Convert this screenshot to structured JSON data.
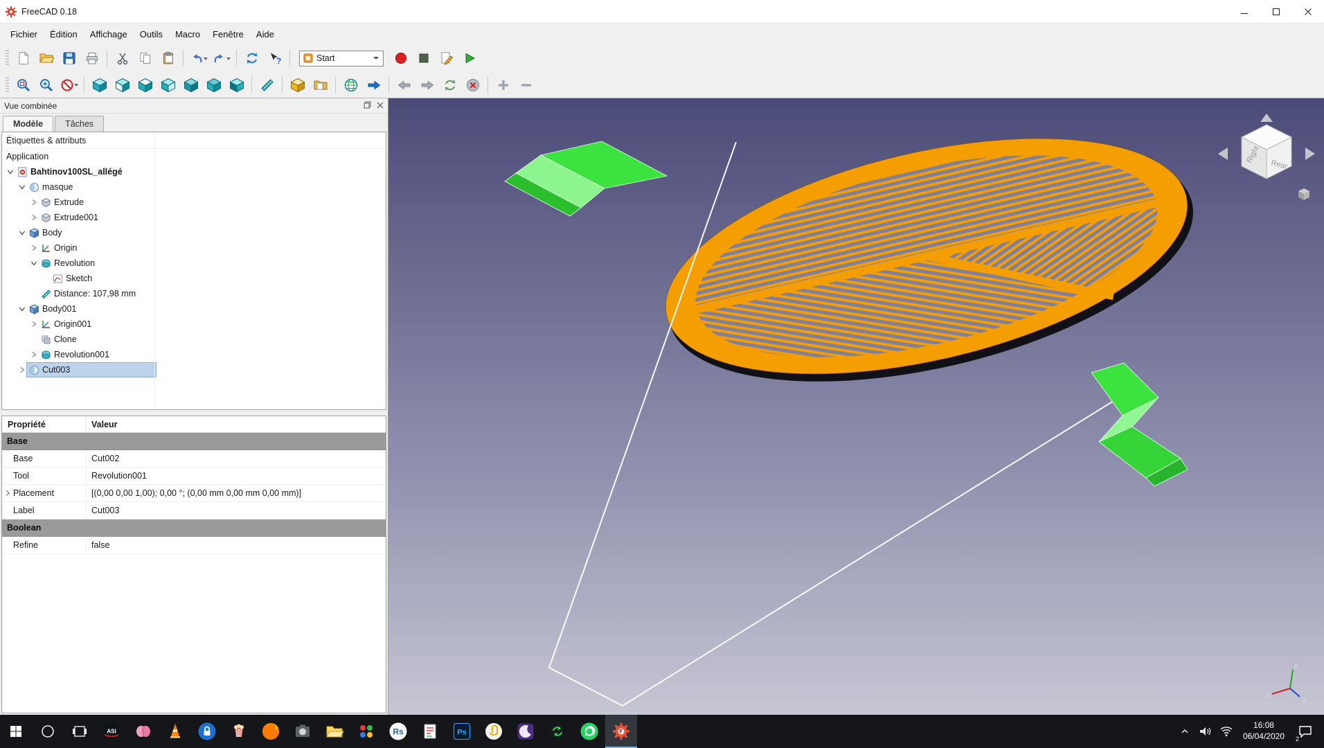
{
  "window": {
    "title": "FreeCAD 0.18"
  },
  "menubar": {
    "items": [
      "Fichier",
      "Édition",
      "Affichage",
      "Outils",
      "Macro",
      "Fenêtre",
      "Aide"
    ]
  },
  "toolbar": {
    "workbench": "Start",
    "row1": [
      "new-file",
      "open-file",
      "save",
      "print",
      "sep",
      "cut",
      "copy",
      "paste",
      "sep",
      "undo",
      "redo",
      "sep",
      "refresh",
      "whats-this",
      "sep",
      "workbench",
      "record-macro",
      "stop-macro",
      "edit-macro",
      "play-macro"
    ],
    "row2": [
      "fit-all",
      "zoom-region",
      "draw-style",
      "sep",
      "view-axonometric",
      "view-front",
      "view-top",
      "view-right",
      "view-rear",
      "view-bottom",
      "view-left",
      "sep",
      "measure-distance",
      "sep",
      "appearance",
      "std-views-folder",
      "sep",
      "web-home",
      "link-go",
      "sep",
      "nav-back",
      "nav-forward",
      "nav-reload",
      "nav-stop",
      "sep",
      "zoom-in",
      "zoom-out"
    ]
  },
  "combined_view": {
    "title": "Vue combinée",
    "tabs": [
      {
        "label": "Modèle"
      },
      {
        "label": "Tâches"
      }
    ],
    "tree_header": "Étiquettes & attributs",
    "root_label": "Application",
    "tree": [
      {
        "label": "Bahtinov100SL_allégé",
        "level": 0,
        "chevron": "expanded",
        "icon": "document",
        "bold": true
      },
      {
        "label": "masque",
        "level": 1,
        "chevron": "expanded",
        "icon": "part"
      },
      {
        "label": "Extrude",
        "level": 2,
        "chevron": "collapsed",
        "icon": "extrude"
      },
      {
        "label": "Extrude001",
        "level": 2,
        "chevron": "collapsed",
        "icon": "extrude"
      },
      {
        "label": "Body",
        "level": 1,
        "chevron": "expanded",
        "icon": "body"
      },
      {
        "label": "Origin",
        "level": 2,
        "chevron": "collapsed",
        "icon": "origin"
      },
      {
        "label": "Revolution",
        "level": 2,
        "chevron": "expanded",
        "icon": "revolution"
      },
      {
        "label": "Sketch",
        "level": 3,
        "chevron": "none",
        "icon": "sketch"
      },
      {
        "label": "Distance: 107,98 mm",
        "level": 2,
        "chevron": "none",
        "icon": "distance"
      },
      {
        "label": "Body001",
        "level": 1,
        "chevron": "expanded",
        "icon": "body"
      },
      {
        "label": "Origin001",
        "level": 2,
        "chevron": "collapsed",
        "icon": "origin"
      },
      {
        "label": "Clone",
        "level": 2,
        "chevron": "none",
        "icon": "clone"
      },
      {
        "label": "Revolution001",
        "level": 2,
        "chevron": "collapsed",
        "icon": "revolution"
      },
      {
        "label": "Cut003",
        "level": 1,
        "chevron": "collapsed",
        "icon": "part",
        "selected": true
      }
    ]
  },
  "properties": {
    "columns": [
      "Propriété",
      "Valeur"
    ],
    "rows": [
      {
        "group": "Base"
      },
      {
        "name": "Base",
        "value": "Cut002"
      },
      {
        "name": "Tool",
        "value": "Revolution001"
      },
      {
        "name": "Placement",
        "value": "[(0,00 0,00 1,00); 0,00 °; (0,00 mm  0,00 mm  0,00 mm)]",
        "expandable": true
      },
      {
        "name": "Label",
        "value": "Cut003"
      },
      {
        "group": "Boolean"
      },
      {
        "name": "Refine",
        "value": "false"
      }
    ]
  },
  "viewport": {
    "nav_cube": {
      "labels": [
        "Right",
        "Rear"
      ]
    },
    "axis_labels": [
      "x",
      "y",
      "z"
    ]
  },
  "taskbar": {
    "items": [
      {
        "name": "start"
      },
      {
        "name": "search"
      },
      {
        "name": "task-view"
      },
      {
        "name": "asi",
        "label": "ASI"
      },
      {
        "name": "brain"
      },
      {
        "name": "vlc"
      },
      {
        "name": "lock"
      },
      {
        "name": "popcorn"
      },
      {
        "name": "firefox"
      },
      {
        "name": "capture"
      },
      {
        "name": "explorer"
      },
      {
        "name": "colors"
      },
      {
        "name": "rstudio",
        "label": "Rs"
      },
      {
        "name": "notes"
      },
      {
        "name": "photoshop",
        "label": "Ps"
      },
      {
        "name": "clip"
      },
      {
        "name": "moon"
      },
      {
        "name": "sync"
      },
      {
        "name": "whatsapp"
      },
      {
        "name": "freecad",
        "active": true
      }
    ],
    "tray": {
      "time": "16:08",
      "date": "06/04/2020",
      "badge": "2"
    }
  }
}
